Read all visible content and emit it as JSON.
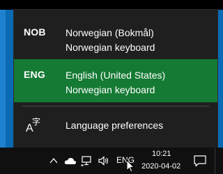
{
  "flyout": {
    "languages": [
      {
        "abbr": "NOB",
        "name": "Norwegian (Bokmål)",
        "keyboard": "Norwegian keyboard",
        "selected": false
      },
      {
        "abbr": "ENG",
        "name": "English (United States)",
        "keyboard": "Norwegian keyboard",
        "selected": true
      }
    ],
    "preferences_label": "Language preferences",
    "selected_color": "#157a34",
    "background_color": "#1f1f1f"
  },
  "taskbar": {
    "tray_icons": [
      "chevron-up-icon",
      "onedrive-cloud-icon",
      "network-icon",
      "volume-icon"
    ],
    "input_indicator": "ENG",
    "clock": {
      "time": "10:21",
      "date": "2020-04-02"
    },
    "notification_icon": "action-center-icon"
  }
}
